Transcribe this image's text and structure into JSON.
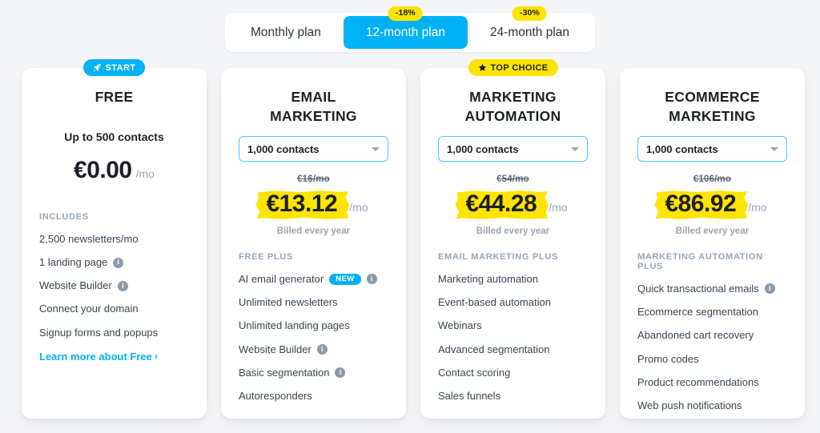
{
  "switcher": {
    "tabs": [
      {
        "label": "Monthly plan",
        "active": false,
        "discount": ""
      },
      {
        "label": "12-month plan",
        "active": true,
        "discount": "-18%"
      },
      {
        "label": "24-month plan",
        "active": false,
        "discount": "-30%"
      }
    ]
  },
  "colors": {
    "accent_blue": "#00b2f5",
    "highlight_yellow": "#ffe400",
    "text_dark": "#1c2026",
    "text_muted": "#9aa5b1",
    "page_bg": "#f4f5f7"
  },
  "cards": [
    {
      "badge": {
        "text": "START",
        "icon": "rocket-icon",
        "style": "start"
      },
      "title_lines": [
        "FREE"
      ],
      "contacts_static": "Up to 500 contacts",
      "select": null,
      "old_price": "",
      "price": "€0.00",
      "per": "/mo",
      "billed": "",
      "features_heading": "INCLUDES",
      "features": [
        {
          "label": "2,500 newsletters/mo",
          "info": false,
          "new": false
        },
        {
          "label": "1 landing page",
          "info": true,
          "new": false
        },
        {
          "label": "Website Builder",
          "info": true,
          "new": false
        },
        {
          "label": "Connect your domain",
          "info": false,
          "new": false
        },
        {
          "label": "Signup forms and popups",
          "info": false,
          "new": false
        }
      ],
      "link": "Learn more about Free",
      "link_chevron": "›"
    },
    {
      "badge": null,
      "title_lines": [
        "EMAIL",
        "MARKETING"
      ],
      "contacts_static": "",
      "select": {
        "value": "1,000 contacts"
      },
      "old_price": "€16/mo",
      "price": "€13.12",
      "per": "/mo",
      "billed": "Billed every year",
      "features_heading": "FREE PLUS",
      "features": [
        {
          "label": "AI email generator",
          "info": true,
          "new": true,
          "new_label": "NEW"
        },
        {
          "label": "Unlimited newsletters",
          "info": false,
          "new": false
        },
        {
          "label": "Unlimited landing pages",
          "info": false,
          "new": false
        },
        {
          "label": "Website Builder",
          "info": true,
          "new": false
        },
        {
          "label": "Basic segmentation",
          "info": true,
          "new": false
        },
        {
          "label": "Autoresponders",
          "info": false,
          "new": false
        }
      ],
      "link": "",
      "link_chevron": ""
    },
    {
      "badge": {
        "text": "TOP CHOICE",
        "icon": "star-icon",
        "style": "top"
      },
      "title_lines": [
        "MARKETING",
        "AUTOMATION"
      ],
      "contacts_static": "",
      "select": {
        "value": "1,000 contacts"
      },
      "old_price": "€54/mo",
      "price": "€44.28",
      "per": "/mo",
      "billed": "Billed every year",
      "features_heading": "EMAIL MARKETING PLUS",
      "features": [
        {
          "label": "Marketing automation",
          "info": false,
          "new": false
        },
        {
          "label": "Event-based automation",
          "info": false,
          "new": false
        },
        {
          "label": "Webinars",
          "info": false,
          "new": false
        },
        {
          "label": "Advanced segmentation",
          "info": false,
          "new": false
        },
        {
          "label": "Contact scoring",
          "info": false,
          "new": false
        },
        {
          "label": "Sales funnels",
          "info": false,
          "new": false
        }
      ],
      "link": "",
      "link_chevron": ""
    },
    {
      "badge": null,
      "title_lines": [
        "ECOMMERCE",
        "MARKETING"
      ],
      "contacts_static": "",
      "select": {
        "value": "1,000 contacts"
      },
      "old_price": "€106/mo",
      "price": "€86.92",
      "per": "/mo",
      "billed": "Billed every year",
      "features_heading": "MARKETING AUTOMATION PLUS",
      "features": [
        {
          "label": "Quick transactional emails",
          "info": true,
          "new": false
        },
        {
          "label": "Ecommerce segmentation",
          "info": false,
          "new": false
        },
        {
          "label": "Abandoned cart recovery",
          "info": false,
          "new": false
        },
        {
          "label": "Promo codes",
          "info": false,
          "new": false
        },
        {
          "label": "Product recommendations",
          "info": false,
          "new": false
        },
        {
          "label": "Web push notifications",
          "info": false,
          "new": false
        }
      ],
      "link": "",
      "link_chevron": ""
    }
  ]
}
